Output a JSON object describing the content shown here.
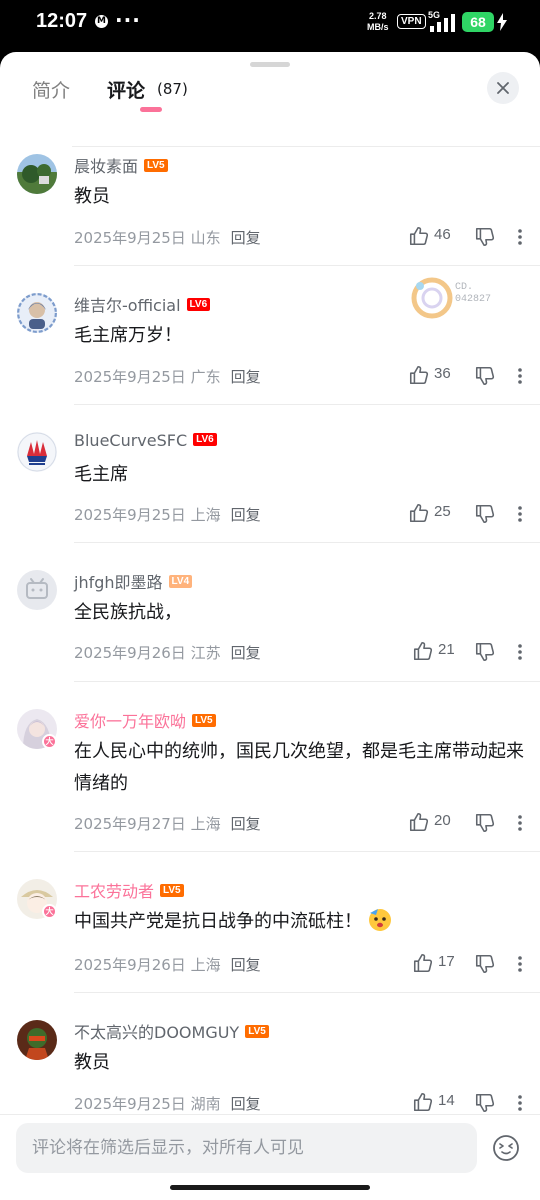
{
  "status_bar": {
    "time": "12:07",
    "app_icon": "M",
    "more": "···",
    "speed_value": "2.78",
    "speed_unit": "MB/s",
    "vpn": "VPN",
    "network": "5G",
    "battery": "68"
  },
  "tabs": {
    "intro": "简介",
    "comments": "评论",
    "count": "(87)"
  },
  "colors": {
    "accent": "#fb7299",
    "level5": "#ff6c00",
    "level6": "#ff0000",
    "level4": "#ffb37c"
  },
  "comments": [
    {
      "user": "晨妆素面",
      "level": "LV5",
      "text": "教员",
      "date": "2025年9月25日",
      "location": "山东",
      "reply": "回复",
      "likes": "46"
    },
    {
      "user": "维吉尔-official",
      "level": "LV6",
      "text": "毛主席万岁！",
      "date": "2025年9月25日",
      "location": "广东",
      "reply": "回复",
      "likes": "36",
      "decoration": "CD.\n042827"
    },
    {
      "user": "BlueCurveSFC",
      "level": "LV6",
      "text": "毛主席",
      "date": "2025年9月25日",
      "location": "上海",
      "reply": "回复",
      "likes": "25"
    },
    {
      "user": "jhfgh即墨路",
      "level": "LV4",
      "text": "全民族抗战，",
      "date": "2025年9月26日",
      "location": "江苏",
      "reply": "回复",
      "likes": "21"
    },
    {
      "user": "爱你一万年欧呦",
      "level": "LV5",
      "text": "在人民心中的统帅，国民几次绝望，都是毛主席带动起来情绪的",
      "date": "2025年9月27日",
      "location": "上海",
      "reply": "回复",
      "likes": "20",
      "badge": "大"
    },
    {
      "user": "工农劳动者",
      "level": "LV5",
      "text": "中国共产党是抗日战争的中流砥柱！",
      "date": "2025年9月26日",
      "location": "上海",
      "reply": "回复",
      "likes": "17",
      "badge": "大"
    },
    {
      "user": "不太高兴的DOOMGUY",
      "level": "LV5",
      "text": "教员",
      "date": "2025年9月25日",
      "location": "湖南",
      "reply": "回复",
      "likes": "14"
    }
  ],
  "input": {
    "placeholder": "评论将在筛选后显示，对所有人可见"
  }
}
